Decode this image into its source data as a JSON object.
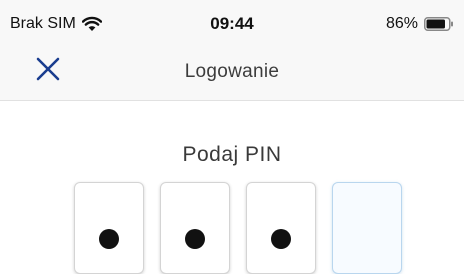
{
  "status_bar": {
    "carrier": "Brak SIM",
    "time": "09:44",
    "battery_percent": "86%",
    "battery_level": 0.86,
    "wifi_icon": "wifi-icon",
    "battery_icon": "battery-icon"
  },
  "nav": {
    "title": "Logowanie",
    "close_icon": "close-icon",
    "accent_color": "#1a3d8f"
  },
  "pin": {
    "label": "Podaj PIN",
    "digits_entered": 3,
    "total_boxes": 4,
    "active_border_color": "#b9d6ee"
  }
}
